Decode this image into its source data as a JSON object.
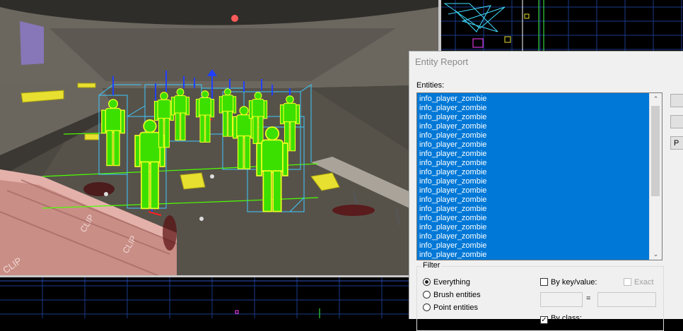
{
  "dialog": {
    "title": "Entity Report",
    "entities_label": "Entities:",
    "entities": [
      "info_player_zombie",
      "info_player_zombie",
      "info_player_zombie",
      "info_player_zombie",
      "info_player_zombie",
      "info_player_zombie",
      "info_player_zombie",
      "info_player_zombie",
      "info_player_zombie",
      "info_player_zombie",
      "info_player_zombie",
      "info_player_zombie",
      "info_player_zombie",
      "info_player_zombie",
      "info_player_zombie",
      "info_player_zombie",
      "info_player_zombie",
      "info_player_zombie"
    ],
    "side_buttons": [
      "",
      "",
      "P"
    ],
    "filter": {
      "label": "Filter",
      "everything_label": "Everything",
      "brush_entities_label": "Brush entities",
      "point_entities_label": "Point entities",
      "selected": "Everything",
      "by_keyvalue_label": "By key/value:",
      "by_keyvalue_checked": false,
      "exact_label": "Exact",
      "exact_checked": false,
      "equals_sign": "=",
      "key_value": "",
      "value_value": "",
      "by_class_label": "By class:",
      "by_class_checked": true
    }
  },
  "viewport3d": {
    "clip_texture_label": "CLIP",
    "colors": {
      "selection_green": "#4cff00",
      "bbox_cyan": "#3fc8ff",
      "axis_blue": "#2040ff",
      "axis_red": "#ff2020",
      "trigger_yellow": "#e8e030"
    }
  },
  "colors": {
    "selection_highlight": "#0078d7",
    "dialog_bg": "#f0f0f0"
  }
}
